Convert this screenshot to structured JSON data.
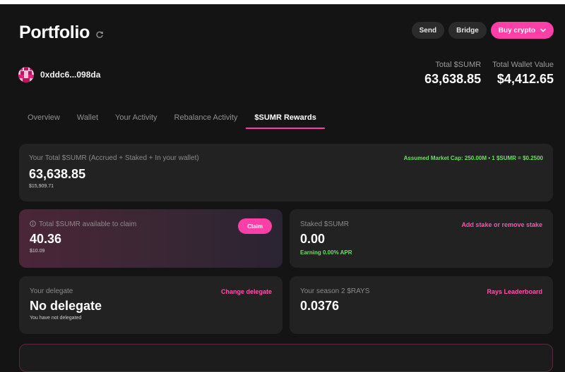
{
  "header": {
    "title": "Portfolio",
    "actions": {
      "send": "Send",
      "bridge": "Bridge",
      "buy": "Buy crypto"
    }
  },
  "wallet": {
    "address": "0xddc6...098da"
  },
  "stats": [
    {
      "label": "Total $SUMR",
      "value": "63,638.85"
    },
    {
      "label": "Total Wallet Value",
      "value": "$4,412.65"
    }
  ],
  "tabs": [
    {
      "label": "Overview",
      "active": false
    },
    {
      "label": "Wallet",
      "active": false
    },
    {
      "label": "Your Activity",
      "active": false
    },
    {
      "label": "Rebalance Activity",
      "active": false
    },
    {
      "label": "$SUMR Rewards",
      "active": true
    }
  ],
  "summary": {
    "label": "Your Total $SUMR (Accrued + Staked + In your wallet)",
    "value": "63,638.85",
    "usd": "$15,909.71",
    "market_info": "Assumed Market Cap: 250.00M • 1 $SUMR = $0.2500"
  },
  "claim": {
    "label": "Total $SUMR available to claim",
    "value": "40.36",
    "usd": "$10.09",
    "button": "Claim"
  },
  "staked": {
    "label": "Staked $SUMR",
    "value": "0.00",
    "apr": "Earning 0.00% APR",
    "link": "Add stake or remove stake"
  },
  "delegate": {
    "label": "Your delegate",
    "value": "No delegate",
    "sub": "You have not delegated",
    "link": "Change delegate"
  },
  "rays": {
    "label": "Your season 2 $RAYS",
    "value": "0.0376",
    "link": "Rays Leaderboard"
  },
  "colors": {
    "accent": "#ff3fa8",
    "positive": "#67e35d",
    "background": "#141414",
    "card": "#222222"
  },
  "icons": {
    "refresh": "refresh-icon",
    "chevron": "chevron-down-icon",
    "info": "info-icon"
  }
}
